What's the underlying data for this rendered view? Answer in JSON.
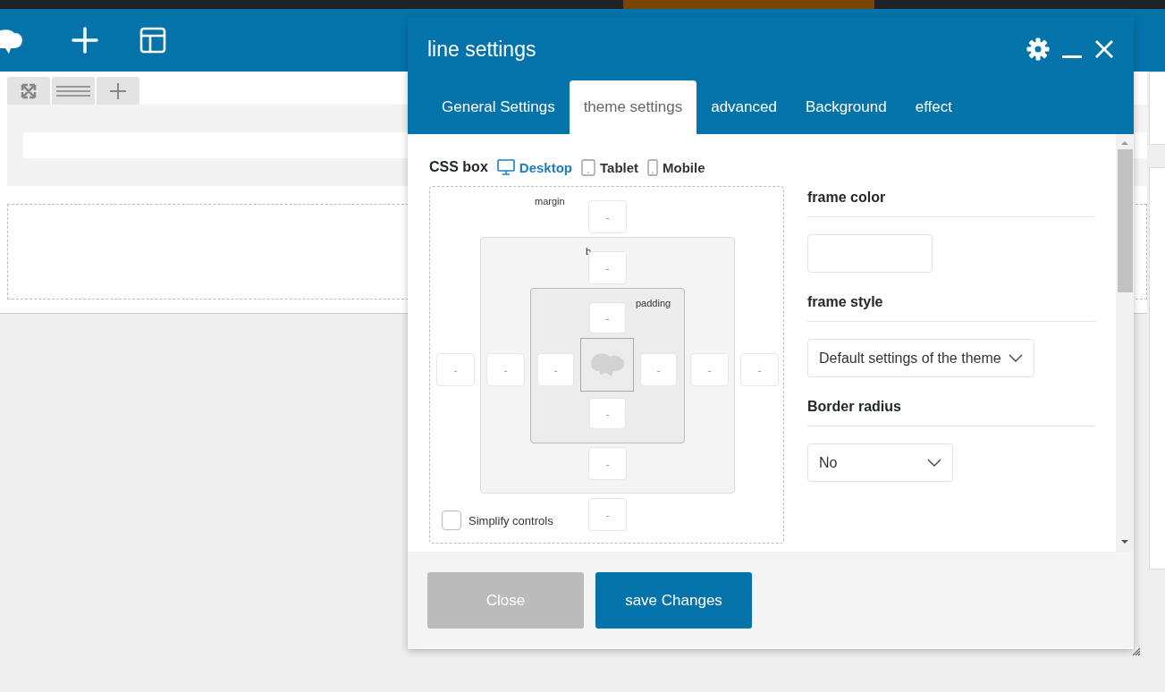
{
  "dialog": {
    "title": "line settings",
    "tabs": [
      {
        "label": "General Settings",
        "selected": false
      },
      {
        "label": "theme settings",
        "selected": true
      },
      {
        "label": "advanced",
        "selected": false
      },
      {
        "label": "Background",
        "selected": false
      },
      {
        "label": "effect",
        "selected": false
      }
    ],
    "css_box": {
      "label": "CSS box",
      "devices": [
        {
          "label": "Desktop",
          "kind": "desktop",
          "selected": true
        },
        {
          "label": "Tablet",
          "kind": "tablet",
          "selected": false
        },
        {
          "label": "Mobile",
          "kind": "mobile",
          "selected": false
        }
      ],
      "margin_label": "margin",
      "border_label": "b",
      "padding_label": "padding",
      "margin": [
        "-",
        "-",
        "-",
        "-"
      ],
      "border": [
        "-",
        "-",
        "-",
        "-"
      ],
      "padding": [
        "-",
        "-",
        "-",
        "-"
      ],
      "simplify": {
        "label": "Simplify controls",
        "checked": false
      }
    },
    "fields": [
      {
        "label": "frame color",
        "kind": "color"
      },
      {
        "label": "frame style",
        "kind": "select",
        "value": "Default settings of the theme"
      },
      {
        "label": "Border radius",
        "kind": "select",
        "value": "No"
      }
    ],
    "buttons": [
      {
        "label": "Close",
        "kind": "secondary"
      },
      {
        "label": "save Changes",
        "kind": "primary"
      }
    ]
  }
}
